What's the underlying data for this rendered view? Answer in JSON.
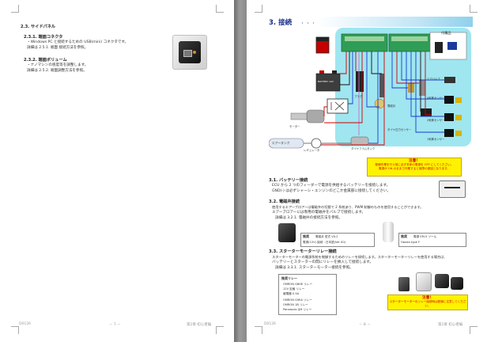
{
  "left_page": {
    "s1_title": "2.3. サイドパネル",
    "s1_sub": "2.3.1. 端面コネクタ",
    "s1_lines": [
      "・Windows PC と接続するための USB(mini) コネクタです。",
      "詳細は 2.5.1. 端面 接続方法を参照。"
    ],
    "s2_sub": "2.3.2. 端面ボリューム",
    "s2_lines": [
      "・ナノマシンの感度等を調整します。",
      "詳細は 2.5.2. 端面調整方法を参照。"
    ],
    "footer_left": "D0126",
    "footer_center": "－ 7 －",
    "footer_right": "第2章 初心者編"
  },
  "right_page": {
    "banner_title": "3. 接続",
    "banner_dots": "・・・",
    "diagram_labels": {
      "accessory": "付属品",
      "battery": "BATTERY 12V",
      "air_tank": "エアータンク",
      "reg_valve": "レギュレータ",
      "plug": "プラグ",
      "motor": "モーター",
      "sensor1": "4気筒センサー",
      "sensor2": "2気筒センサー",
      "sensor3": "1気筒センサー",
      "air_valve": "エアバルブ",
      "solenoid": "電磁弁",
      "diagnostic": "ダイヤフラムタンク",
      "tire": "タイヤ圧力センサー"
    },
    "warn_top": {
      "title": "注意！",
      "lines": [
        "配線作業を行う前に必ず本体の電源を OFF にしてください。",
        "電源が ON のままで作業すると故障の原因となります。"
      ]
    },
    "s1_title": "3.1. バッテリー接続",
    "s1_lines": [
      "ECU から 2 つのフィーダーで電源を供給するバッテリーを接続します。",
      "GND(-) は必ずシャーシ・エンジンのどこか金属部に接続してください。"
    ],
    "s2_title": "3.2. 電磁弁接続",
    "s2_lines": [
      "使用するエアーブロアーは電磁弁の切替で 2 系統あり、PWM 制御のものを使用することができます。",
      "エアーブロアーには専用の電磁弁をバルブで接続します。"
    ],
    "s2_ref": "詳細は 3.2.1. 電磁弁の接続方法を参照。",
    "box1_title": "推奨",
    "box1_lines": [
      "電磁弁 型式 VX-2",
      "電源(12V) 接続 : 日本語(Ver 00)"
    ],
    "box2_title": "推奨",
    "box2_lines": [
      "電源 EM-5 ツール",
      "Honda type F"
    ],
    "s3_title": "3.3. スターターモーターリレー接続",
    "s3_lines": [
      "スターターモーターの電源系統を制御するためのリレーを接続します。スターターモーターリレーを使用する場合は、",
      "バッテリーとスターターの間にリレーを挿入して接続します。"
    ],
    "s3_ref": "詳細は 3.3.1. スターターモーター接続を参照。",
    "box3_title": "推奨リレー",
    "box3_lines": [
      "OMRON G8HE リレー",
      "12V 定格 リレー",
      "継電器 0.5A",
      "OMRON G9EA リレー",
      "OMRON 1B リレー",
      "Panasonic JJM リレー"
    ],
    "warn_bottom": {
      "title": "注意！",
      "lines": [
        "スターターモーターのリレー接続時は配線に注意してください。"
      ]
    },
    "footer_left": "D0126",
    "footer_center": "－ 8 －",
    "footer_right": "第2章 初心者編"
  }
}
